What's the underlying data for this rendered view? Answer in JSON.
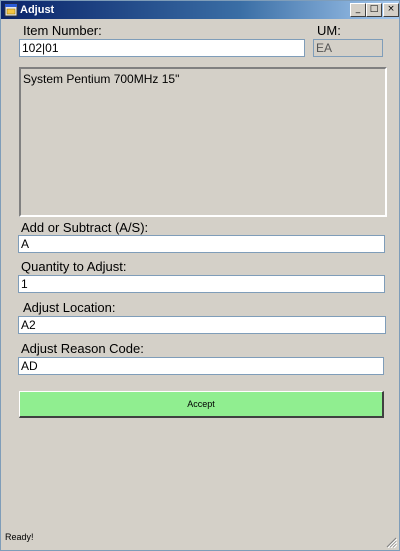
{
  "window": {
    "title": "Adjust",
    "controls": {
      "minimize": "_",
      "maximize": "□",
      "close": "×"
    }
  },
  "form": {
    "item_number_label": "Item Number:",
    "item_number_value": "102|01",
    "um_label": "UM:",
    "um_value": "EA",
    "description": "System Pentium 700MHz 15\"",
    "add_subtract_label": "Add or Subtract (A/S):",
    "add_subtract_value": "A",
    "quantity_label": "Quantity to Adjust:",
    "quantity_value": "1",
    "location_label": "Adjust Location:",
    "location_value": "A2",
    "reason_label": "Adjust Reason Code:",
    "reason_value": "AD",
    "accept_label": "Accept"
  },
  "status_text": "Ready!",
  "icons": {
    "app": "app-window-icon",
    "resize": "resize-grip-icon"
  },
  "colors": {
    "accept_button": "#90ee90",
    "titlebar": "#0a246a"
  }
}
